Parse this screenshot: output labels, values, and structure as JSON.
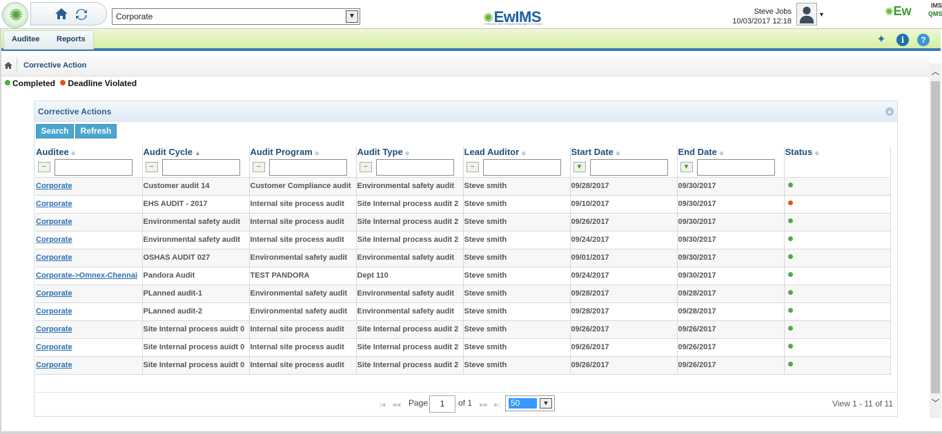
{
  "header": {
    "org_selected": "Corporate",
    "brand_center": "EwIMS",
    "brand_center_sub": "Enterprise wide Integrated Management System",
    "user_name": "Steve Jobs",
    "user_datetime": "10/03/2017 12:18",
    "brand_right": "Ew",
    "brand_right_ims": "IMS",
    "brand_right_qms": "QMS"
  },
  "menu": {
    "items": [
      "Auditee",
      "Reports"
    ],
    "icons": [
      "pin-icon",
      "info-icon",
      "help-icon"
    ]
  },
  "breadcrumb": {
    "title": "Corrective Action"
  },
  "legend": {
    "completed": "Completed",
    "deadline": "Deadline Violated",
    "colors": {
      "completed": "#4cae3f",
      "deadline": "#e8511a"
    }
  },
  "panel": {
    "title": "Corrective Actions",
    "search_label": "Search",
    "refresh_label": "Refresh",
    "columns": [
      "Auditee",
      "Audit Cycle",
      "Audit Program",
      "Audit Type",
      "Lead Auditor",
      "Start Date",
      "End Date",
      "Status"
    ],
    "rows": [
      {
        "auditee": "Corporate",
        "cycle": "Customer audit 14",
        "program": "Customer Compliance audit",
        "type": "Environmental safety audit",
        "lead": "Steve smith",
        "start": "09/28/2017",
        "end": "09/30/2017",
        "status": "completed"
      },
      {
        "auditee": "Corporate",
        "cycle": "EHS AUDIT - 2017",
        "program": "Internal site process audit",
        "type": "Site Internal process audit 2",
        "lead": "Steve smith",
        "start": "09/10/2017",
        "end": "09/30/2017",
        "status": "deadline"
      },
      {
        "auditee": "Corporate",
        "cycle": "Environmental safety audit",
        "program": "Internal site process audit",
        "type": "Site Internal process audit 2",
        "lead": "Steve smith",
        "start": "09/26/2017",
        "end": "09/30/2017",
        "status": "completed"
      },
      {
        "auditee": "Corporate",
        "cycle": "Environmental safety audit",
        "program": "Internal site process audit",
        "type": "Site Internal process audit 2",
        "lead": "Steve smith",
        "start": "09/24/2017",
        "end": "09/30/2017",
        "status": "completed"
      },
      {
        "auditee": "Corporate",
        "cycle": "OSHAS AUDIT 027",
        "program": "Environmental safety audit",
        "type": "Environmental safety audit",
        "lead": "Steve smith",
        "start": "09/01/2017",
        "end": "09/30/2017",
        "status": "completed"
      },
      {
        "auditee": "Corporate->Omnex-Chennai",
        "cycle": "Pandora Audit",
        "program": "TEST PANDORA",
        "type": "Dept 110",
        "lead": "Steve smith",
        "start": "09/24/2017",
        "end": "09/30/2017",
        "status": "completed"
      },
      {
        "auditee": "Corporate",
        "cycle": "PLanned audit-1",
        "program": "Environmental safety audit",
        "type": "Environmental safety audit",
        "lead": "Steve smith",
        "start": "09/28/2017",
        "end": "09/28/2017",
        "status": "completed"
      },
      {
        "auditee": "Corporate",
        "cycle": "PLanned audit-2",
        "program": "Environmental safety audit",
        "type": "Environmental safety audit",
        "lead": "Steve smith",
        "start": "09/28/2017",
        "end": "09/28/2017",
        "status": "completed"
      },
      {
        "auditee": "Corporate",
        "cycle": "Site Internal process auidt 0",
        "program": "Internal site process audit",
        "type": "Site Internal process audit 2",
        "lead": "Steve smith",
        "start": "09/26/2017",
        "end": "09/26/2017",
        "status": "completed"
      },
      {
        "auditee": "Corporate",
        "cycle": "Site Internal process auidt 0",
        "program": "Internal site process audit",
        "type": "Site Internal process audit 2",
        "lead": "Steve smith",
        "start": "09/26/2017",
        "end": "09/26/2017",
        "status": "completed"
      },
      {
        "auditee": "Corporate",
        "cycle": "Site Internal process auidt 0",
        "program": "Internal site process audit",
        "type": "Site Internal process audit 2",
        "lead": "Steve smith",
        "start": "09/26/2017",
        "end": "09/26/2017",
        "status": "completed"
      }
    ]
  },
  "pager": {
    "page_label": "Page",
    "page_value": "1",
    "of_label": "of 1",
    "page_size": "50",
    "view_text": "View 1 - 11 of 11"
  }
}
